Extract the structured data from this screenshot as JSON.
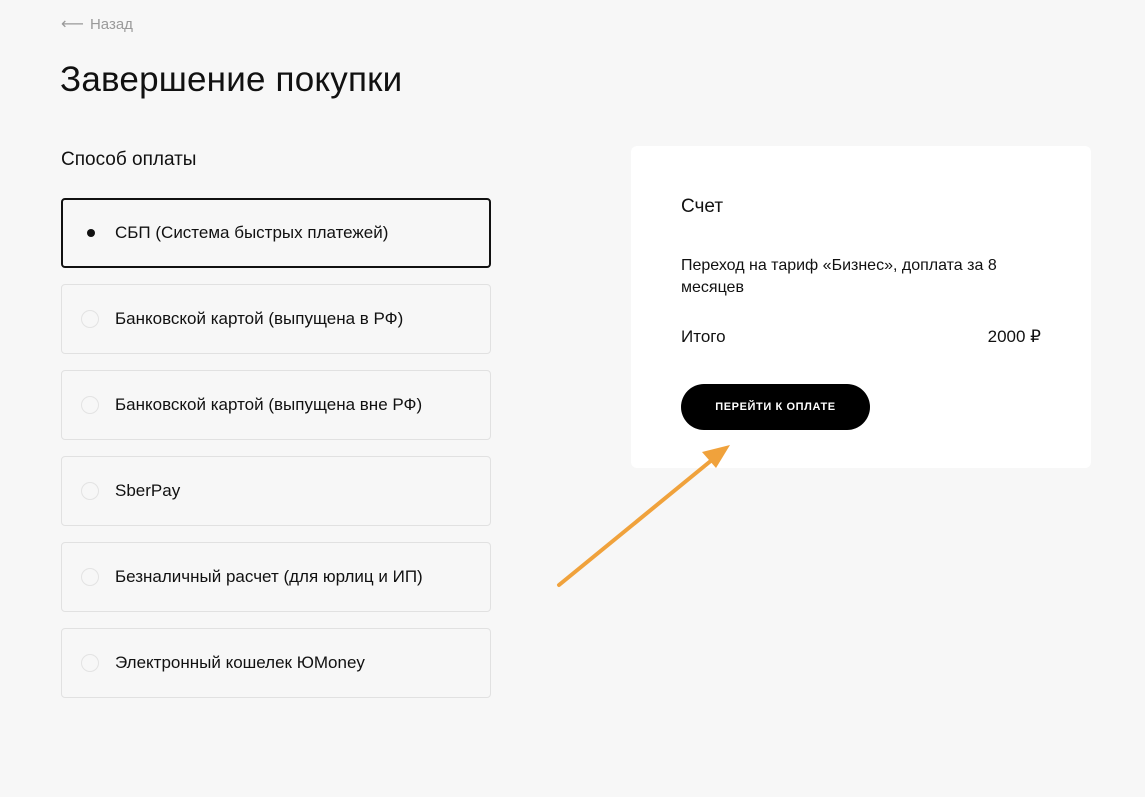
{
  "back": {
    "label": "Назад",
    "icon": "arrow-left-icon"
  },
  "page_title": "Завершение покупки",
  "payment": {
    "section_title": "Способ оплаты",
    "selected_index": 0,
    "methods": [
      {
        "label": "СБП (Система быстрых платежей)"
      },
      {
        "label": "Банковской картой (выпущена в РФ)"
      },
      {
        "label": "Банковской картой (выпущена вне РФ)"
      },
      {
        "label": "SberPay"
      },
      {
        "label": "Безналичный расчет (для юрлиц и ИП)"
      },
      {
        "label": "Электронный кошелек ЮMoney"
      }
    ]
  },
  "invoice": {
    "title": "Счет",
    "description": "Переход на тариф «Бизнес», доплата за 8 месяцев",
    "total_label": "Итого",
    "total_value": "2000 ₽",
    "pay_button_label": "ПЕРЕЙТИ К ОПЛАТЕ"
  },
  "colors": {
    "background": "#f7f7f7",
    "card": "#ffffff",
    "button": "#000000",
    "annotation_arrow": "#f0a23c"
  }
}
